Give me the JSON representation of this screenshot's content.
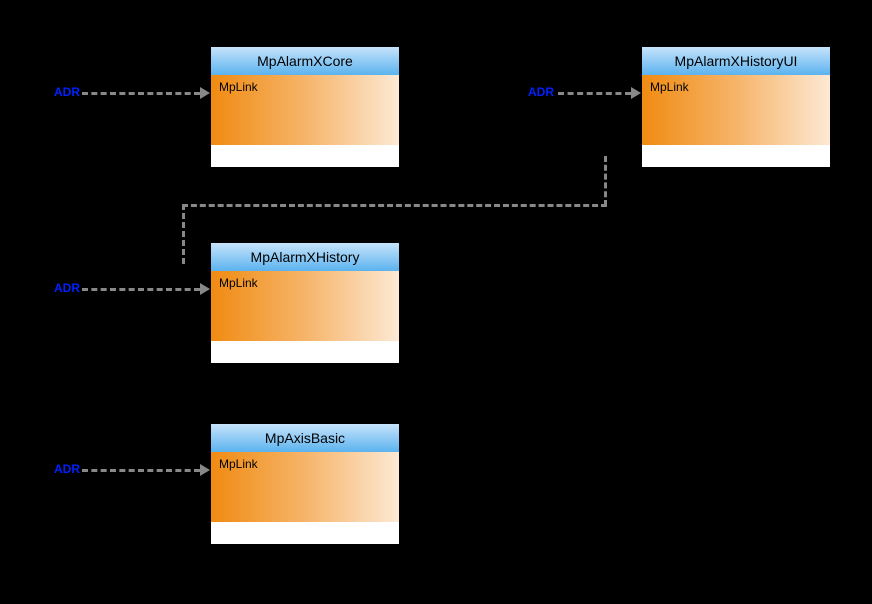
{
  "blocks": {
    "core": {
      "title": "MpAlarmXCore",
      "body": "MpLink"
    },
    "history": {
      "title": "MpAlarmXHistory",
      "body": "MpLink"
    },
    "axis": {
      "title": "MpAxisBasic",
      "body": "MpLink"
    },
    "histui": {
      "title": "MpAlarmXHistoryUI",
      "body": "MpLink"
    }
  },
  "labels": {
    "adr": "ADR"
  }
}
